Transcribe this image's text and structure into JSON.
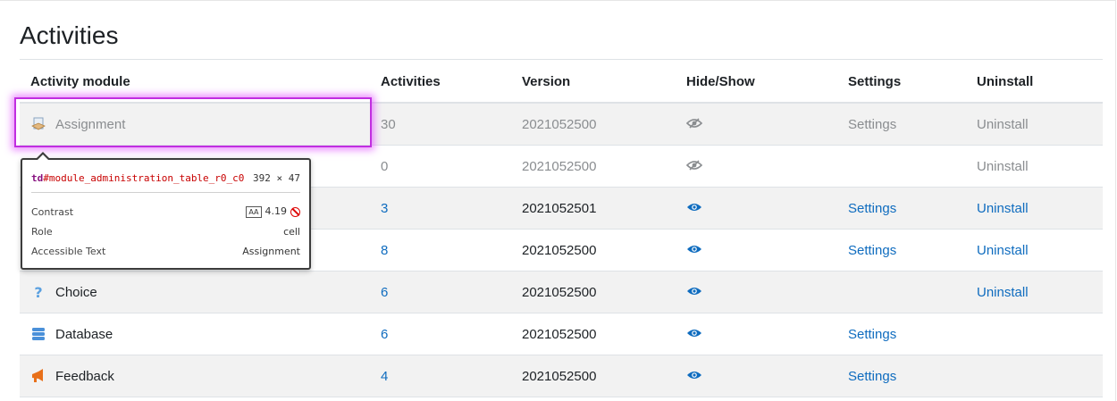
{
  "page": {
    "title": "Activities"
  },
  "table": {
    "headers": {
      "module": "Activity module",
      "activities": "Activities",
      "version": "Version",
      "hideshow": "Hide/Show",
      "settings": "Settings",
      "uninstall": "Uninstall"
    },
    "rows": [
      {
        "name": "Assignment",
        "icon": "assignment-icon",
        "activities": "30",
        "version": "2021052500",
        "visibility": "hidden",
        "settings": "Settings",
        "uninstall": "Uninstall"
      },
      {
        "name": "",
        "icon": "",
        "activities": "0",
        "version": "2021052500",
        "visibility": "hidden",
        "settings": "",
        "uninstall": "Uninstall"
      },
      {
        "name": "",
        "icon": "",
        "activities": "3",
        "version": "2021052501",
        "visibility": "visible",
        "settings": "Settings",
        "uninstall": "Uninstall"
      },
      {
        "name": "",
        "icon": "",
        "activities": "8",
        "version": "2021052500",
        "visibility": "visible",
        "settings": "Settings",
        "uninstall": "Uninstall"
      },
      {
        "name": "Choice",
        "icon": "choice-icon",
        "activities": "6",
        "version": "2021052500",
        "visibility": "visible",
        "settings": "",
        "uninstall": "Uninstall"
      },
      {
        "name": "Database",
        "icon": "database-icon",
        "activities": "6",
        "version": "2021052500",
        "visibility": "visible",
        "settings": "Settings",
        "uninstall": ""
      },
      {
        "name": "Feedback",
        "icon": "feedback-icon",
        "activities": "4",
        "version": "2021052500",
        "visibility": "visible",
        "settings": "Settings",
        "uninstall": ""
      }
    ]
  },
  "inspector": {
    "tag": "td",
    "id": "#module_administration_table_r0_c0",
    "size": "392 × 47",
    "contrast_label": "Contrast",
    "contrast_badge": "AA",
    "contrast_value": "4.19",
    "role_label": "Role",
    "role_value": "cell",
    "accessible_label": "Accessible Text",
    "accessible_value": "Assignment"
  },
  "colors": {
    "link": "#0f6cbf",
    "dimmed": "#8a8d90",
    "highlight": "#c12ee0"
  }
}
